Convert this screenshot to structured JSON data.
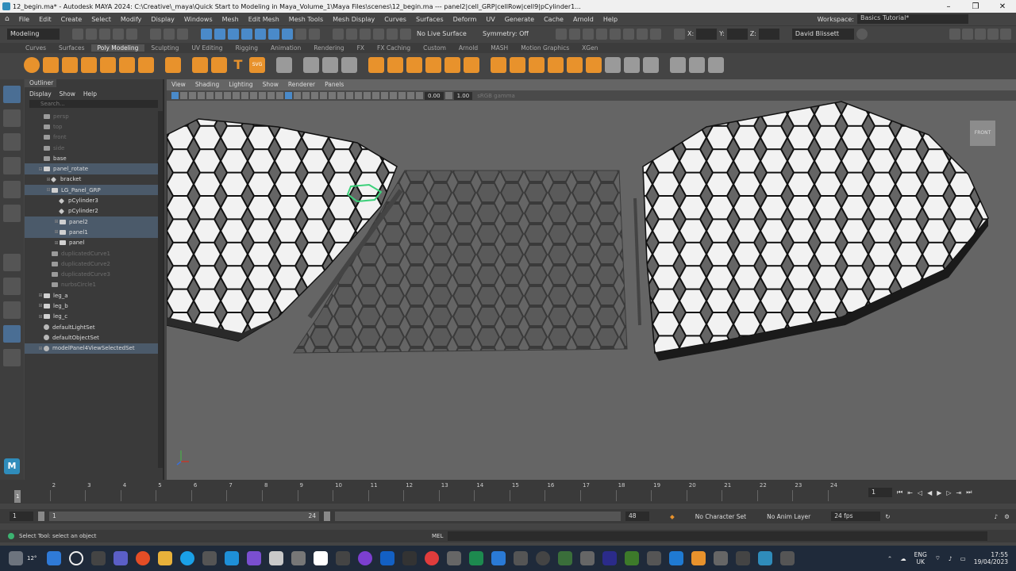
{
  "window": {
    "title": "12_begin.ma* - Autodesk MAYA 2024: C:\\Creative\\_maya\\Quick Start to Modeling in Maya_Volume_1\\Maya Files\\scenes\\12_begin.ma   ---   panel2|cell_GRP|cellRow|cell9|pCylinder1...",
    "minimize": "–",
    "maximize": "❐",
    "close": "✕"
  },
  "menubar": {
    "items": [
      "File",
      "Edit",
      "Create",
      "Select",
      "Modify",
      "Display",
      "Windows",
      "Mesh",
      "Edit Mesh",
      "Mesh Tools",
      "Mesh Display",
      "Curves",
      "Surfaces",
      "Deform",
      "UV",
      "Generate",
      "Cache",
      "Arnold",
      "Help"
    ],
    "workspace_label": "Workspace:",
    "workspace_value": "Basics Tutorial*"
  },
  "statusline": {
    "mode": "Modeling",
    "live_surface": "No Live Surface",
    "symmetry": "Symmetry: Off",
    "x_label": "X:",
    "y_label": "Y:",
    "z_label": "Z:",
    "user": "David Blissett"
  },
  "shelf": {
    "tabs": [
      "Curves",
      "Surfaces",
      "Poly Modeling",
      "Sculpting",
      "UV Editing",
      "Rigging",
      "Animation",
      "Rendering",
      "FX",
      "FX Caching",
      "Custom",
      "Arnold",
      "MASH",
      "Motion Graphics",
      "XGen"
    ],
    "active_tab": "Poly Modeling",
    "svg_label": "SVG"
  },
  "outliner": {
    "title": "Outliner",
    "menu": [
      "Display",
      "Show",
      "Help"
    ],
    "search_placeholder": "Search...",
    "items": [
      {
        "label": "persp",
        "dim": true,
        "indent": 1,
        "icon": "camera"
      },
      {
        "label": "top",
        "dim": true,
        "indent": 1,
        "icon": "camera"
      },
      {
        "label": "front",
        "dim": true,
        "indent": 1,
        "icon": "camera"
      },
      {
        "label": "side",
        "dim": true,
        "indent": 1,
        "icon": "camera"
      },
      {
        "label": "base",
        "dim": false,
        "indent": 1,
        "icon": "camera"
      },
      {
        "label": "panel_rotate",
        "dim": false,
        "indent": 1,
        "icon": "group",
        "exp": "⊟",
        "hl": true
      },
      {
        "label": "bracket",
        "dim": false,
        "indent": 2,
        "icon": "mesh",
        "exp": "⊞"
      },
      {
        "label": "LG_Panel_GRP",
        "dim": false,
        "indent": 2,
        "icon": "group",
        "exp": "⊟",
        "hl": true
      },
      {
        "label": "pCylinder3",
        "dim": false,
        "indent": 3,
        "icon": "mesh"
      },
      {
        "label": "pCylinder2",
        "dim": false,
        "indent": 3,
        "icon": "mesh"
      },
      {
        "label": "panel2",
        "dim": false,
        "indent": 3,
        "icon": "group",
        "exp": "⊞",
        "hl": true
      },
      {
        "label": "panel1",
        "dim": false,
        "indent": 3,
        "icon": "group",
        "exp": "⊞",
        "hl": true
      },
      {
        "label": "panel",
        "dim": false,
        "indent": 3,
        "icon": "group",
        "exp": "⊞"
      },
      {
        "label": "duplicatedCurve1",
        "dim": true,
        "indent": 2,
        "icon": "curve"
      },
      {
        "label": "duplicatedCurve2",
        "dim": true,
        "indent": 2,
        "icon": "curve"
      },
      {
        "label": "duplicatedCurve3",
        "dim": true,
        "indent": 2,
        "icon": "curve"
      },
      {
        "label": "nurbsCircle1",
        "dim": true,
        "indent": 2,
        "icon": "curve"
      },
      {
        "label": "leg_a",
        "dim": false,
        "indent": 1,
        "icon": "group",
        "exp": "⊞"
      },
      {
        "label": "leg_b",
        "dim": false,
        "indent": 1,
        "icon": "group",
        "exp": "⊞"
      },
      {
        "label": "leg_c",
        "dim": false,
        "indent": 1,
        "icon": "group",
        "exp": "⊞"
      },
      {
        "label": "defaultLightSet",
        "dim": false,
        "indent": 1,
        "icon": "set"
      },
      {
        "label": "defaultObjectSet",
        "dim": false,
        "indent": 1,
        "icon": "set"
      },
      {
        "label": "modelPanel4ViewSelectedSet",
        "dim": false,
        "indent": 1,
        "icon": "set",
        "exp": "⊞",
        "hl": true
      }
    ]
  },
  "viewport": {
    "menu": [
      "View",
      "Shading",
      "Lighting",
      "Show",
      "Renderer",
      "Panels"
    ],
    "exposure": "0.00",
    "gamma": "1.00",
    "colorspace": "sRGB gamma",
    "cube_label": "FRONT"
  },
  "timeslider": {
    "ticks": [
      1,
      2,
      3,
      4,
      5,
      6,
      7,
      8,
      9,
      10,
      11,
      12,
      13,
      14,
      15,
      16,
      17,
      18,
      19,
      20,
      21,
      22,
      23,
      24
    ],
    "current_frame": "1",
    "start": "1",
    "end": "24"
  },
  "range": {
    "start": "1",
    "inner_start": "1",
    "inner_end": "24",
    "end": "24",
    "outer_end": "48",
    "character_set": "No Character Set",
    "anim_layer": "No Anim Layer",
    "fps": "24 fps"
  },
  "helpline": {
    "text": "Select Tool: select an object",
    "mel": "MEL"
  },
  "taskbar": {
    "weather": "12°",
    "lang": "ENG",
    "region": "UK",
    "time": "17:55",
    "date": "19/04/2023"
  },
  "colors": {
    "accent": "#4a8ac9",
    "shelf_orange": "#e8922c",
    "viewport_bg": "#656565"
  }
}
